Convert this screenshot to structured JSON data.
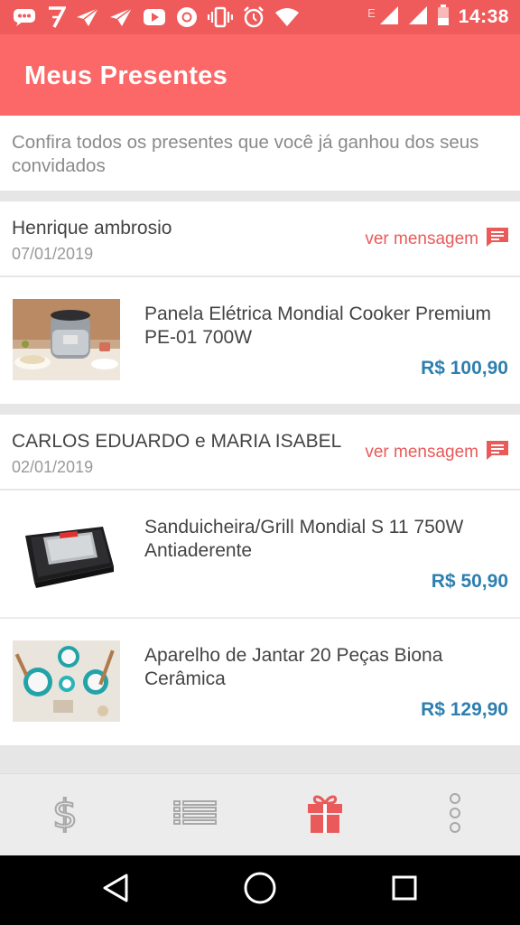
{
  "status_bar": {
    "time": "14:38",
    "network_letter": "E",
    "icons": [
      "message-icon",
      "seven-icon",
      "send-icon",
      "send-icon",
      "youtube-icon",
      "chrome-icon",
      "vibrate-icon",
      "alarm-icon",
      "wifi-icon",
      "signal-icon",
      "signal-icon",
      "battery-icon"
    ]
  },
  "header": {
    "title": "Meus Presentes"
  },
  "intro": {
    "text": "Confira todos os presentes que você já ganhou dos seus convidados"
  },
  "groups": [
    {
      "sender": "Henrique ambrosio",
      "date": "07/01/2019",
      "message_link": "ver mensagem",
      "items": [
        {
          "name": "Panela Elétrica Mondial Cooker Premium PE-01 700W",
          "price": "R$ 100,90",
          "image": "rice-cooker-photo"
        }
      ]
    },
    {
      "sender": "CARLOS EDUARDO e MARIA ISABEL",
      "date": "02/01/2019",
      "message_link": "ver mensagem",
      "items": [
        {
          "name": "Sanduicheira/Grill Mondial S 11 750W Antiaderente",
          "price": "R$ 50,90",
          "image": "sandwich-maker-photo"
        },
        {
          "name": "Aparelho de Jantar 20 Peças Biona Cerâmica",
          "price": "R$ 129,90",
          "image": "dinner-set-photo"
        }
      ]
    }
  ],
  "bottom_nav": {
    "items": [
      {
        "icon": "dollar-icon",
        "active": false
      },
      {
        "icon": "list-icon",
        "active": false
      },
      {
        "icon": "gift-icon",
        "active": true
      },
      {
        "icon": "more-vertical-icon",
        "active": false
      }
    ]
  },
  "colors": {
    "status_bar": "#ef5b5b",
    "app_bar": "#fc6868",
    "accent": "#ea5a5a",
    "price": "#2e7fb0",
    "nav_inactive": "#a8a8a8"
  }
}
